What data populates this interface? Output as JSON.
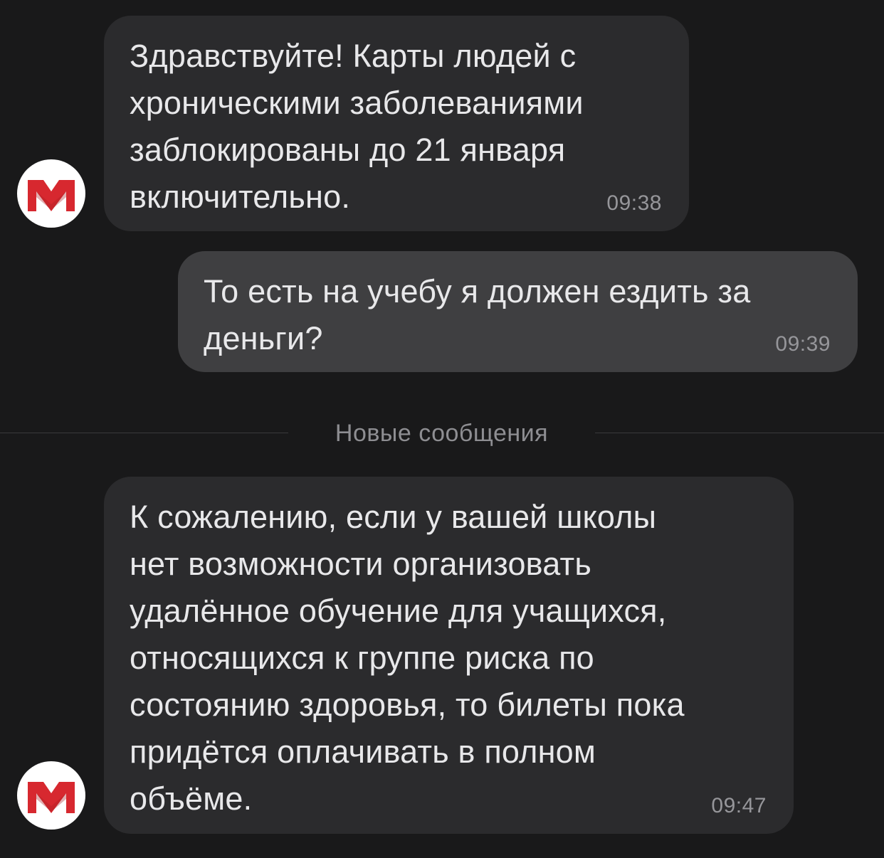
{
  "messages": [
    {
      "direction": "incoming",
      "text": "Здравствуйте! Карты людей с\nхроническими заболеваниями\nзаблокированы до 21 января\nвключительно.",
      "time": "09:38",
      "avatar_icon": "metro-logo-icon"
    },
    {
      "direction": "outgoing",
      "text": "То есть на учебу я должен ездить за\nденьги?",
      "time": "09:39"
    },
    {
      "direction": "incoming",
      "text": "К сожалению, если у вашей школы\nнет возможности организовать\nудалённое обучение для учащихся,\nотносящихся к группе риска по\nсостоянию здоровья, то билеты пока\nпридётся оплачивать в полном\nобъёме.",
      "time": "09:47",
      "avatar_icon": "metro-logo-icon"
    }
  ],
  "divider": {
    "label": "Новые сообщения"
  },
  "colors": {
    "background": "#19191a",
    "incoming_bubble": "#2b2b2d",
    "outgoing_bubble": "#3f3f41",
    "logo_red": "#d7282f",
    "avatar_bg": "#ffffff"
  }
}
